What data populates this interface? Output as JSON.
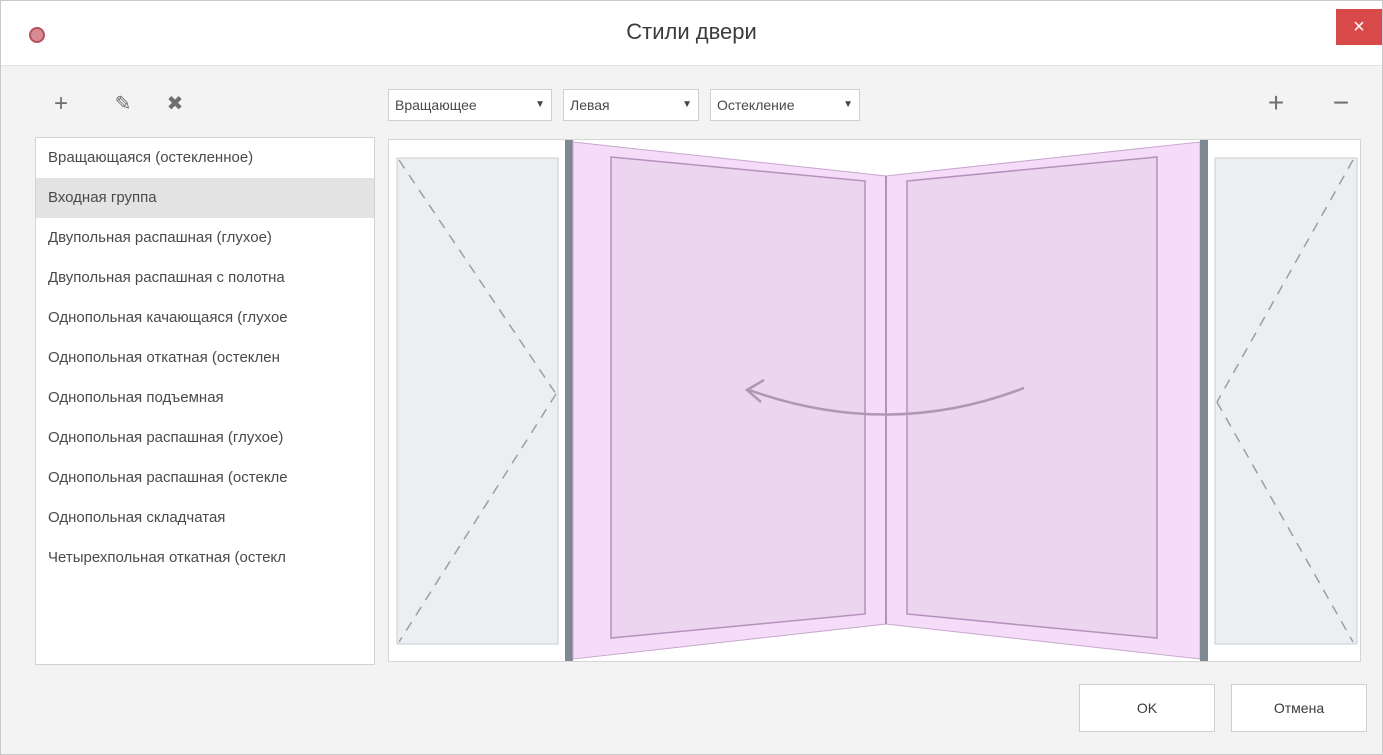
{
  "window": {
    "title": "Стили двери"
  },
  "toolbar": {
    "close_glyph": "×",
    "add_glyph": "+",
    "edit_glyph": "✎",
    "delete_glyph": "✖"
  },
  "styles_list": [
    "Вращающаяся (остекленное)",
    "Входная группа",
    "Двупольная распашная (глухое)",
    "Двупольная распашная с полотна",
    "Однопольная качающаяся (глухое",
    "Однопольная откатная (остеклен",
    "Однопольная подъемная",
    "Однопольная распашная (глухое)",
    "Однопольная распашная (остекле",
    "Однопольная складчатая",
    "Четырехпольная откатная (остекл"
  ],
  "selected_index": 1,
  "dropdowns": {
    "type": "Вращающее",
    "side": "Левая",
    "filling": "Остекление"
  },
  "right_toolbar": {
    "plus": "+",
    "minus": "−"
  },
  "buttons": {
    "ok": "OK",
    "cancel": "Отмена"
  },
  "colors": {
    "door_fill": "#ecd5ef",
    "door_frame": "#f5dcf8",
    "wall": "#eceff2",
    "close": "#d84a4a"
  }
}
